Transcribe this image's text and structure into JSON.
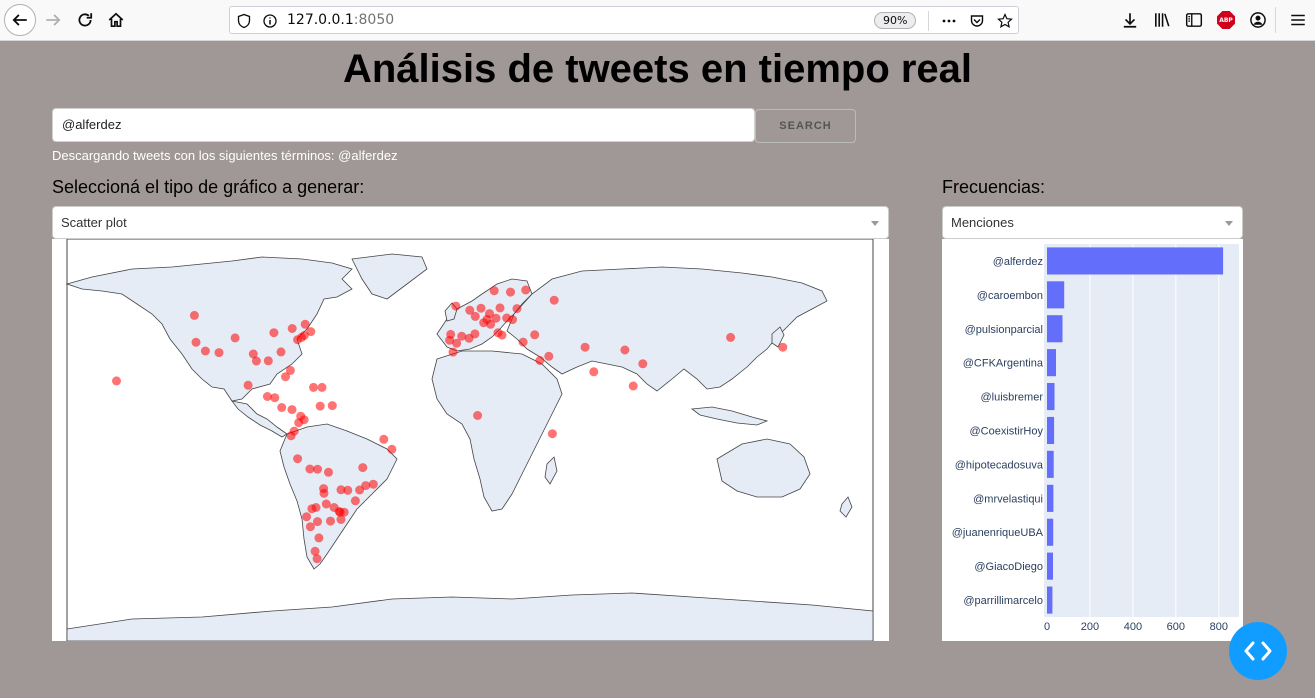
{
  "browser": {
    "url_host": "127.0.0.1",
    "url_port": ":8050",
    "zoom": "90%",
    "abp_label": "ABP"
  },
  "page": {
    "title": "Análisis de tweets en tiempo real",
    "search_value": "@alferdez",
    "search_button": "SEARCH",
    "status": "Descargando tweets con los siguientes términos: @alferdez",
    "chart_type_label": "Seleccioná el tipo de gráfico a generar:",
    "chart_type_selected": "Scatter plot",
    "freq_label": "Frecuencias:",
    "freq_selected": "Menciones"
  },
  "colors": {
    "background": "#a09897",
    "land": "#e5ecf6",
    "marker": "#ff0000",
    "bar": "#636efa",
    "fab": "#119dff"
  },
  "chart_data": [
    {
      "type": "scatter",
      "map": "world",
      "marker_color": "#ff0000",
      "points": [
        {
          "lon": -157.9,
          "lat": 21.3
        },
        {
          "lon": -123.1,
          "lat": 49.3
        },
        {
          "lon": -122.4,
          "lat": 37.8
        },
        {
          "lon": -118.2,
          "lat": 34.1
        },
        {
          "lon": -112.1,
          "lat": 33.4
        },
        {
          "lon": -104.9,
          "lat": 39.7
        },
        {
          "lon": -99.1,
          "lat": 19.4
        },
        {
          "lon": -96.8,
          "lat": 32.8
        },
        {
          "lon": -95.4,
          "lat": 29.8
        },
        {
          "lon": -90.1,
          "lat": 29.9
        },
        {
          "lon": -87.6,
          "lat": 41.9
        },
        {
          "lon": -84.4,
          "lat": 33.7
        },
        {
          "lon": -80.2,
          "lat": 25.8
        },
        {
          "lon": -79.4,
          "lat": 43.7
        },
        {
          "lon": -77.0,
          "lat": 38.9
        },
        {
          "lon": -75.2,
          "lat": 39.9
        },
        {
          "lon": -74.0,
          "lat": 40.7
        },
        {
          "lon": -71.1,
          "lat": 42.4
        },
        {
          "lon": -73.6,
          "lat": 45.5
        },
        {
          "lon": -90.5,
          "lat": 14.6
        },
        {
          "lon": -87.2,
          "lat": 14.1
        },
        {
          "lon": -84.1,
          "lat": 9.9
        },
        {
          "lon": -79.5,
          "lat": 9.0
        },
        {
          "lon": -82.4,
          "lat": 23.1
        },
        {
          "lon": -69.9,
          "lat": 18.5
        },
        {
          "lon": -66.1,
          "lat": 18.5
        },
        {
          "lon": -66.9,
          "lat": 10.5
        },
        {
          "lon": -61.5,
          "lat": 10.7
        },
        {
          "lon": -74.1,
          "lat": 4.7
        },
        {
          "lon": -75.6,
          "lat": 6.2
        },
        {
          "lon": -76.5,
          "lat": 3.4
        },
        {
          "lon": -78.5,
          "lat": -0.2
        },
        {
          "lon": -79.9,
          "lat": -2.2
        },
        {
          "lon": -77.0,
          "lat": -12.0
        },
        {
          "lon": -71.5,
          "lat": -16.4
        },
        {
          "lon": -68.1,
          "lat": -16.5
        },
        {
          "lon": -63.2,
          "lat": -17.8
        },
        {
          "lon": -57.6,
          "lat": -25.3
        },
        {
          "lon": -54.6,
          "lat": -25.5
        },
        {
          "lon": -56.2,
          "lat": -34.9
        },
        {
          "lon": -58.4,
          "lat": -34.6
        },
        {
          "lon": -58.0,
          "lat": -34.9
        },
        {
          "lon": -57.6,
          "lat": -38.0
        },
        {
          "lon": -60.7,
          "lat": -32.9
        },
        {
          "lon": -64.2,
          "lat": -31.4
        },
        {
          "lon": -68.8,
          "lat": -32.9
        },
        {
          "lon": -65.4,
          "lat": -24.8
        },
        {
          "lon": -65.2,
          "lat": -26.8
        },
        {
          "lon": -62.3,
          "lat": -38.7
        },
        {
          "lon": -68.1,
          "lat": -38.9
        },
        {
          "lon": -71.3,
          "lat": -41.1
        },
        {
          "lon": -67.5,
          "lat": -45.9
        },
        {
          "lon": -69.2,
          "lat": -51.6
        },
        {
          "lon": -68.3,
          "lat": -54.8
        },
        {
          "lon": -70.6,
          "lat": -33.4
        },
        {
          "lon": -73.0,
          "lat": -36.8
        },
        {
          "lon": -46.6,
          "lat": -23.5
        },
        {
          "lon": -43.2,
          "lat": -22.9
        },
        {
          "lon": -51.2,
          "lat": -30.0
        },
        {
          "lon": -49.3,
          "lat": -25.4
        },
        {
          "lon": -47.9,
          "lat": -15.8
        },
        {
          "lon": -38.5,
          "lat": -3.7
        },
        {
          "lon": -34.9,
          "lat": -8.0
        },
        {
          "lon": -9.1,
          "lat": 38.7
        },
        {
          "lon": -8.6,
          "lat": 41.2
        },
        {
          "lon": -3.7,
          "lat": 40.4
        },
        {
          "lon": 2.2,
          "lat": 41.4
        },
        {
          "lon": -0.4,
          "lat": 39.5
        },
        {
          "lon": -5.98,
          "lat": 37.4
        },
        {
          "lon": 2.35,
          "lat": 48.9
        },
        {
          "lon": -0.1,
          "lat": 51.5
        },
        {
          "lon": -6.3,
          "lat": 53.3
        },
        {
          "lon": 4.9,
          "lat": 52.4
        },
        {
          "lon": 13.4,
          "lat": 52.5
        },
        {
          "lon": 8.7,
          "lat": 50.1
        },
        {
          "lon": 11.6,
          "lat": 48.1
        },
        {
          "lon": 12.5,
          "lat": 41.9
        },
        {
          "lon": 9.2,
          "lat": 45.5
        },
        {
          "lon": 14.3,
          "lat": 40.9
        },
        {
          "lon": 16.4,
          "lat": 48.2
        },
        {
          "lon": 21.0,
          "lat": 52.2
        },
        {
          "lon": 10.8,
          "lat": 59.9
        },
        {
          "lon": 18.1,
          "lat": 59.3
        },
        {
          "lon": 24.9,
          "lat": 60.2
        },
        {
          "lon": 23.7,
          "lat": 37.9
        },
        {
          "lon": 19.0,
          "lat": 47.5
        },
        {
          "lon": 7.6,
          "lat": 47.6
        },
        {
          "lon": 6.1,
          "lat": 46.2
        },
        {
          "lon": 37.6,
          "lat": 55.8
        },
        {
          "lon": 28.9,
          "lat": 41.0
        },
        {
          "lon": 35.2,
          "lat": 31.8
        },
        {
          "lon": 31.2,
          "lat": 30.0
        },
        {
          "lon": 55.3,
          "lat": 25.2
        },
        {
          "lon": 51.4,
          "lat": 35.7
        },
        {
          "lon": 69.2,
          "lat": 34.5
        },
        {
          "lon": 77.2,
          "lat": 28.6
        },
        {
          "lon": 72.9,
          "lat": 19.1
        },
        {
          "lon": 116.4,
          "lat": 39.9
        },
        {
          "lon": 139.7,
          "lat": 35.7
        },
        {
          "lon": -7.6,
          "lat": 33.6
        },
        {
          "lon": 3.4,
          "lat": 6.5
        },
        {
          "lon": 36.8,
          "lat": -1.3
        }
      ]
    },
    {
      "type": "bar",
      "orientation": "horizontal",
      "categories": [
        "@alferdez",
        "@caroembon",
        "@pulsionparcial",
        "@CFKArgentina",
        "@luisbremer",
        "@CoexistirHoy",
        "@hipotecadosuva",
        "@mrvelastiqui",
        "@juanenriqueUBA",
        "@GiacoDiego",
        "@parrillimarcelo"
      ],
      "values": [
        820,
        80,
        72,
        42,
        35,
        33,
        31,
        30,
        29,
        28,
        25
      ],
      "xticks": [
        "0",
        "200",
        "400",
        "600",
        "800"
      ],
      "xlim": [
        0,
        880
      ],
      "grid": true,
      "bar_color": "#636efa"
    }
  ]
}
